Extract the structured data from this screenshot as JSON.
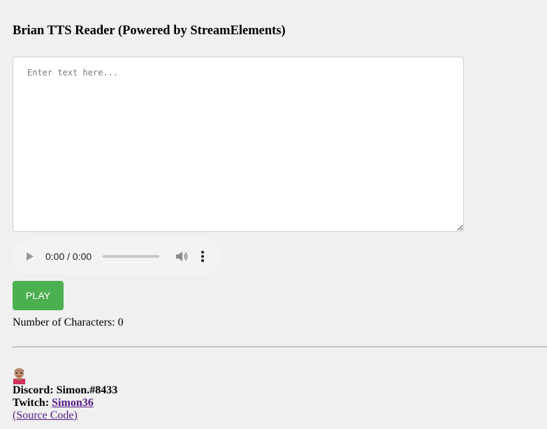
{
  "header": {
    "title": "Brian TTS Reader (Powered by StreamElements)"
  },
  "text_input": {
    "placeholder": "Enter text here...",
    "value": ""
  },
  "audio_player": {
    "time_display": "0:00 / 0:00",
    "progress_fraction": 0,
    "icons": {
      "play": "play-icon",
      "volume": "volume-icon",
      "menu": "more-options-icon"
    },
    "background_color": "#f1f3f4"
  },
  "play_button": {
    "label": "PLAY",
    "color": "#4caf50"
  },
  "char_count": {
    "label": "Number of Characters: ",
    "value": "0"
  },
  "footer": {
    "discord_label": "Discord:",
    "discord_value": "Simon.#8433",
    "twitch_label": "Twitch:",
    "twitch_link": "Simon36",
    "source_link": "(Source Code)",
    "link_color": "#551a8b"
  }
}
